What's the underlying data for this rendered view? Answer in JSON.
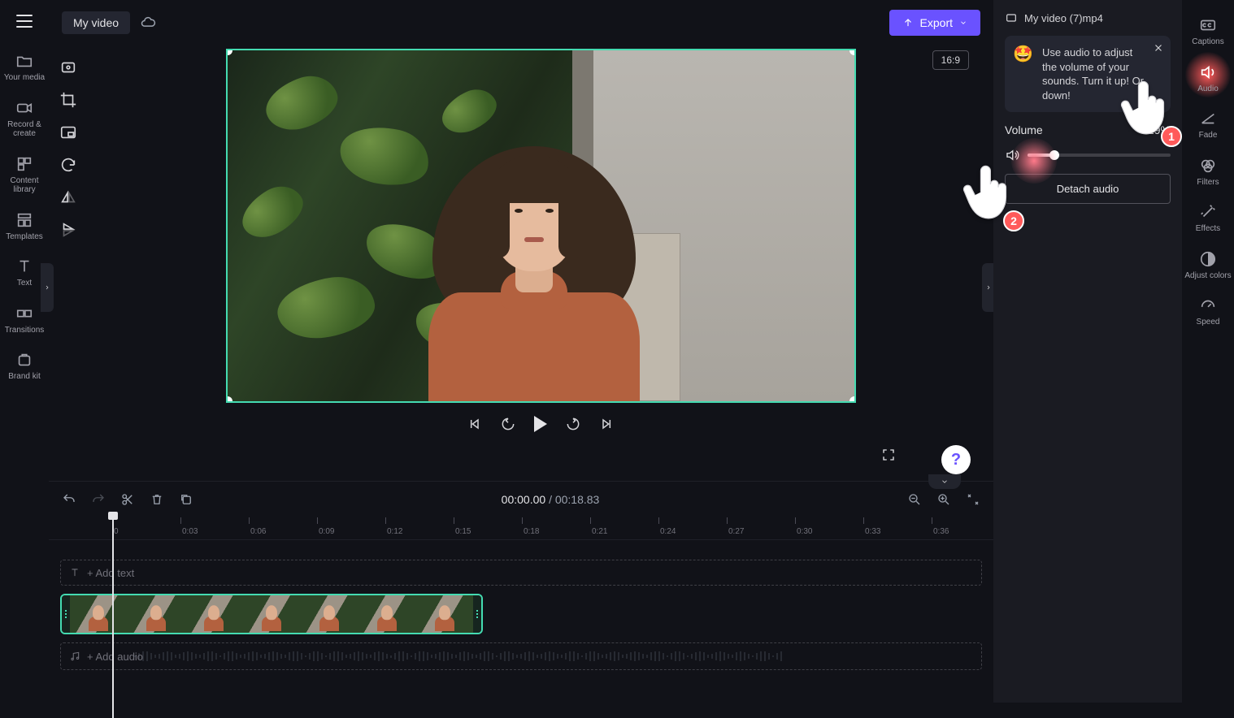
{
  "topbar": {
    "project_name": "My video",
    "export_label": "Export"
  },
  "left_rail": [
    {
      "id": "your-media",
      "label": "Your media",
      "icon": "folder-icon"
    },
    {
      "id": "record-create",
      "label": "Record & create",
      "icon": "camera-icon"
    },
    {
      "id": "content-library",
      "label": "Content library",
      "icon": "library-icon"
    },
    {
      "id": "templates",
      "label": "Templates",
      "icon": "templates-icon"
    },
    {
      "id": "text",
      "label": "Text",
      "icon": "text-icon"
    },
    {
      "id": "transitions",
      "label": "Transitions",
      "icon": "transitions-icon"
    },
    {
      "id": "brand-kit",
      "label": "Brand kit",
      "icon": "brandkit-icon"
    }
  ],
  "preview": {
    "aspect_label": "16:9"
  },
  "timeline": {
    "current_time": "00:00.00",
    "total_time": "00:18.83",
    "ticks": [
      "0",
      "0:03",
      "0:06",
      "0:09",
      "0:12",
      "0:15",
      "0:18",
      "0:21",
      "0:24",
      "0:27",
      "0:30",
      "0:33",
      "0:36"
    ],
    "add_text_label": "+ Add text",
    "add_audio_label": "+ Add audio"
  },
  "audio_panel": {
    "filename": "My video (7)mp4",
    "tip_text": "Use audio to adjust the volume of your sounds. Turn it up! Or down!",
    "volume_label": "Volume",
    "volume_value": "19%",
    "volume_percent": 19,
    "detach_label": "Detach audio"
  },
  "far_rail": [
    {
      "id": "captions",
      "label": "Captions",
      "icon": "cc-icon"
    },
    {
      "id": "audio",
      "label": "Audio",
      "icon": "speaker-icon",
      "active": true
    },
    {
      "id": "fade",
      "label": "Fade",
      "icon": "fade-icon"
    },
    {
      "id": "filters",
      "label": "Filters",
      "icon": "filters-icon"
    },
    {
      "id": "effects",
      "label": "Effects",
      "icon": "effects-icon"
    },
    {
      "id": "adjust-colors",
      "label": "Adjust colors",
      "icon": "adjust-icon"
    },
    {
      "id": "speed",
      "label": "Speed",
      "icon": "speed-icon"
    }
  ],
  "cursors": {
    "step1": "1",
    "step2": "2"
  }
}
